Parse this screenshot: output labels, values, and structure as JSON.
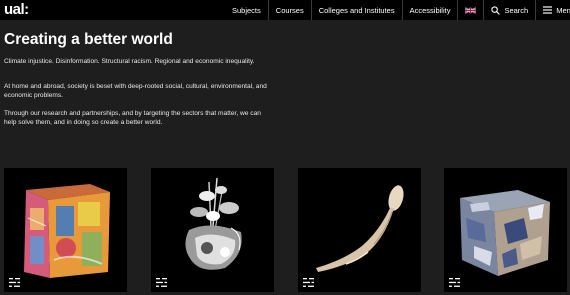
{
  "header": {
    "logo": "ual:",
    "nav": {
      "subjects": "Subjects",
      "courses": "Courses",
      "colleges": "Colleges and Institutes",
      "accessibility": "Accessibility",
      "search": "Search",
      "menu": "Menu"
    }
  },
  "main": {
    "title": "Creating a better world",
    "paragraphs": [
      "Climate injustice. Disinformation. Structural racism. Regional and economic inequality.",
      "At home and abroad, society is beset with deep-rooted social, cultural, environmental, and economic problems.",
      "Through our research and partnerships, and by targeting the sectors that matter, we can help solve them, and in doing so create a better world."
    ]
  },
  "cards": [
    {
      "icon": "filter-icon",
      "art": "colorful-patterned-cube"
    },
    {
      "icon": "filter-icon",
      "art": "chrome-floral-sculpture"
    },
    {
      "icon": "filter-icon",
      "art": "bone-spoon-object"
    },
    {
      "icon": "filter-icon",
      "art": "fractured-metallic-cube"
    }
  ],
  "colors": {
    "background": "#1e1e1e",
    "header": "#000000",
    "text": "#ffffff"
  }
}
